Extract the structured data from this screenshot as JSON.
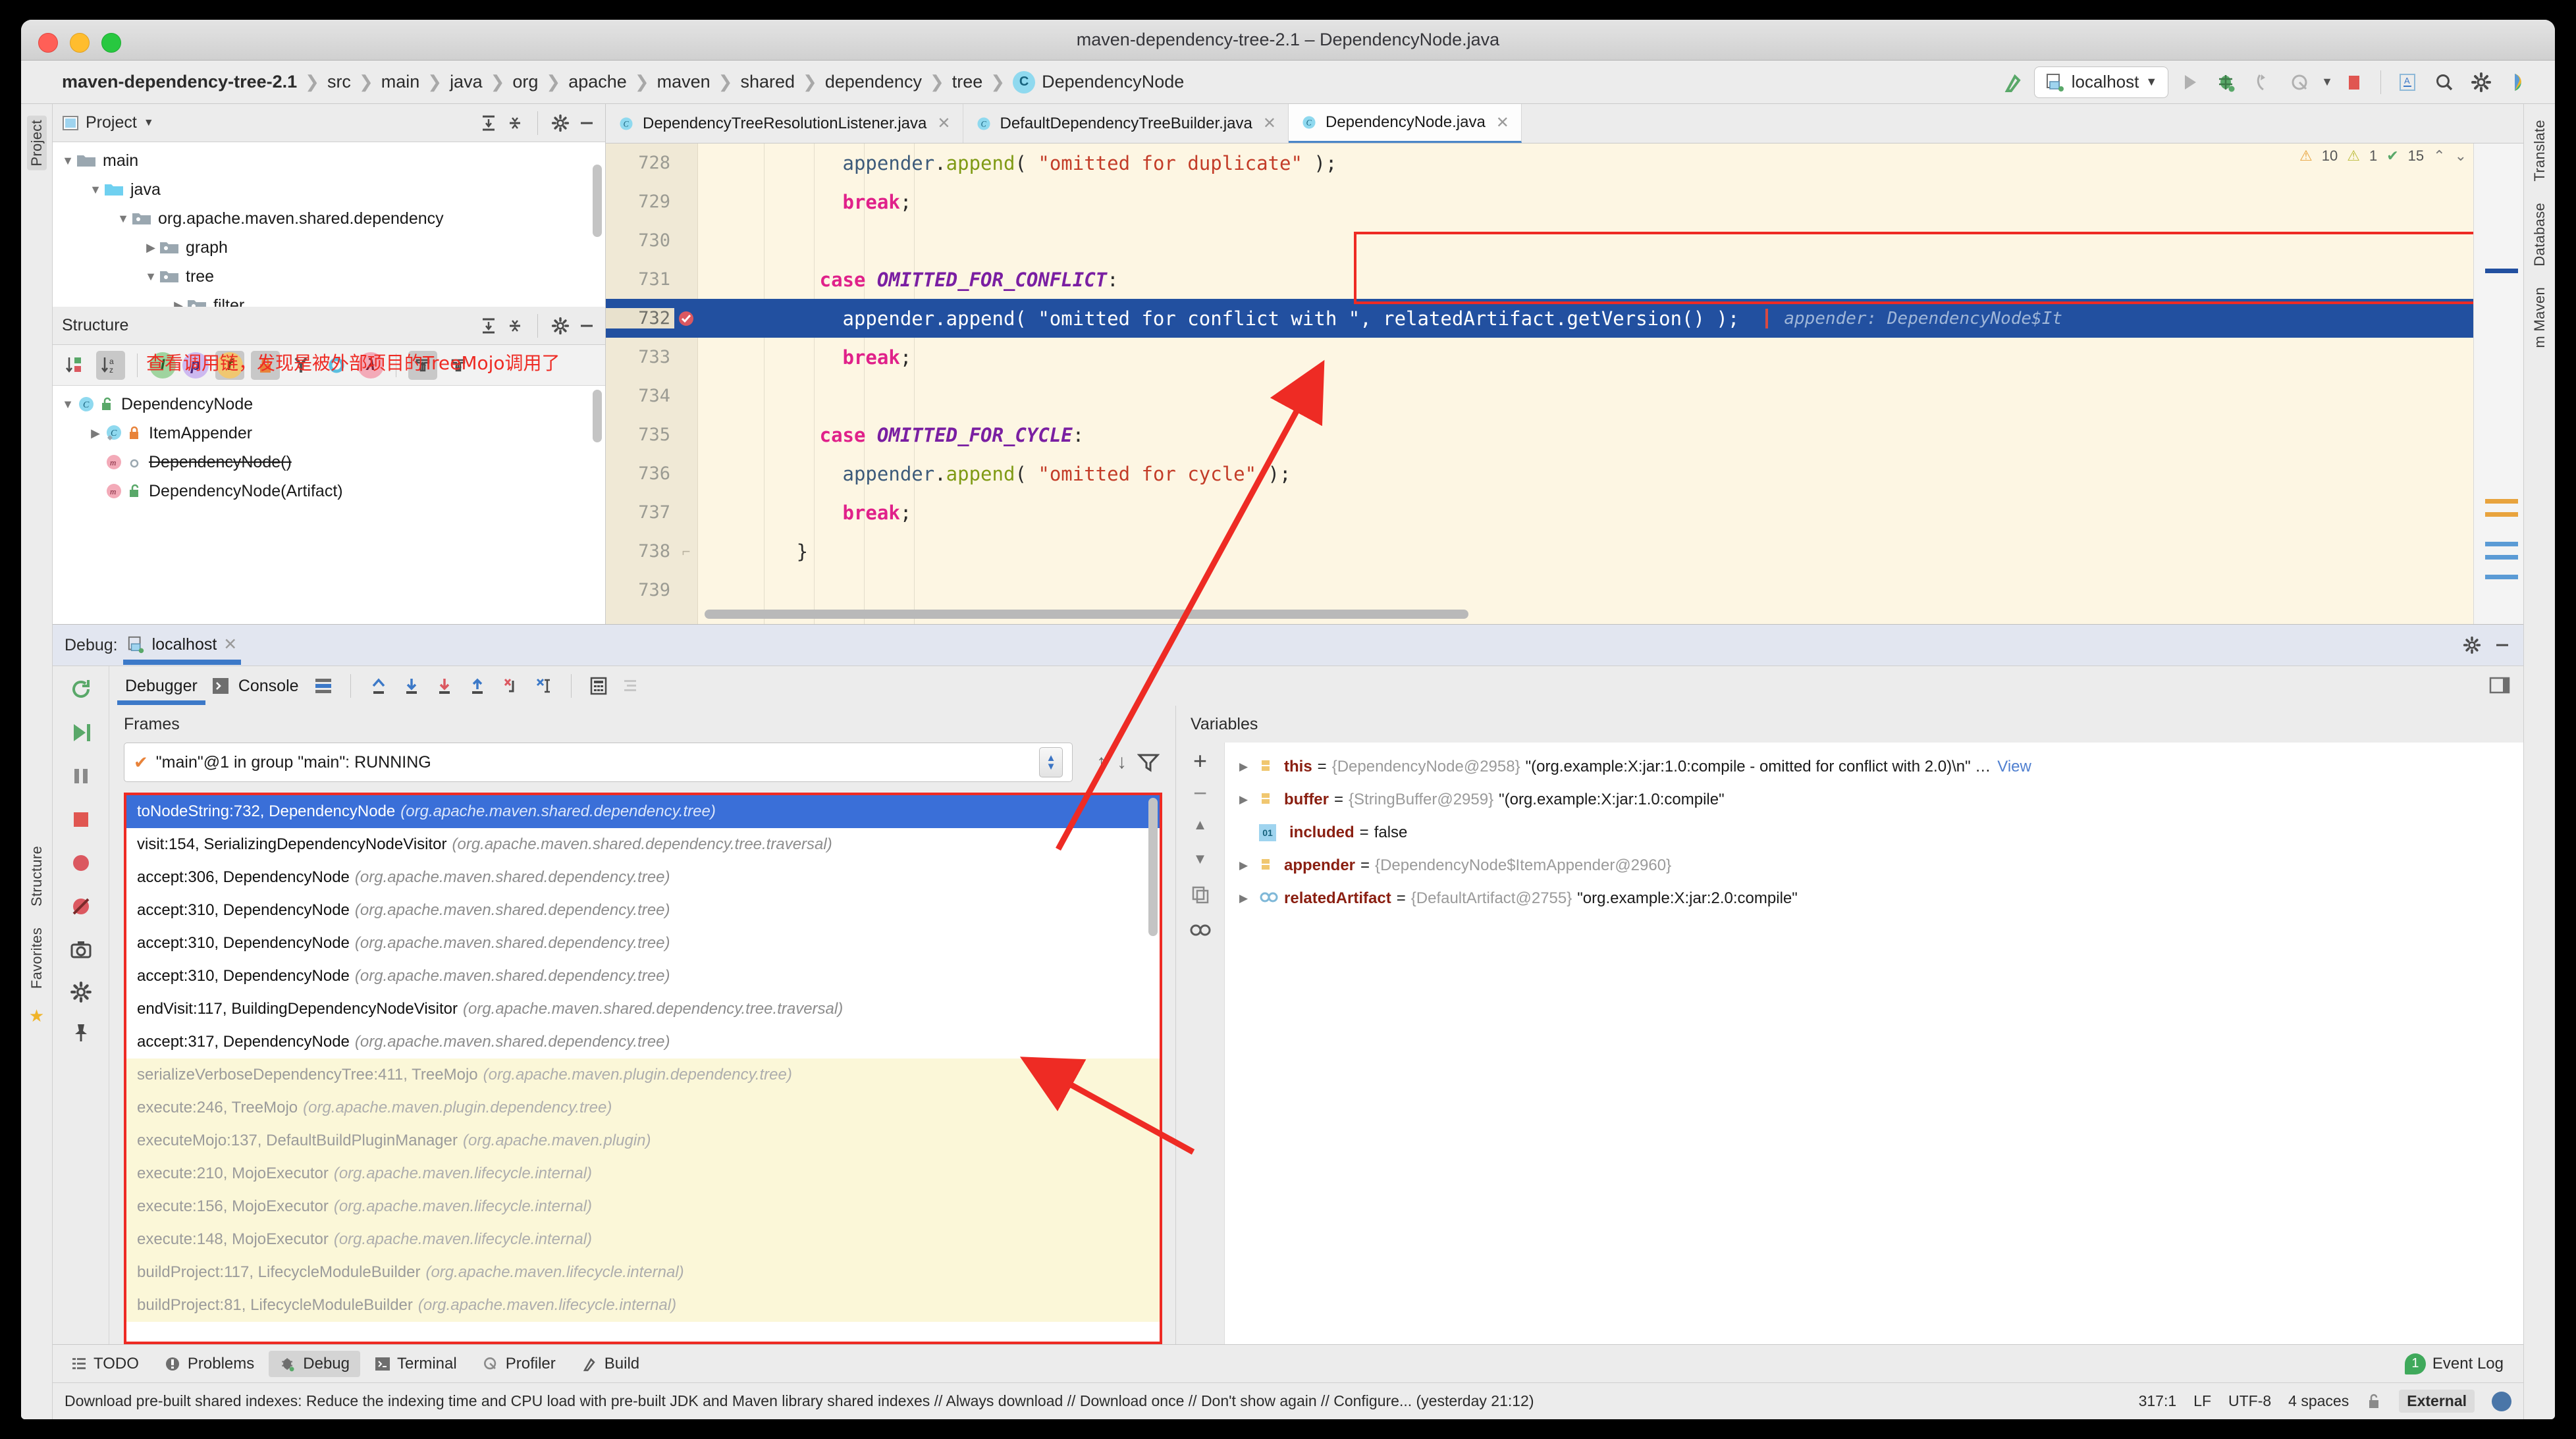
{
  "window": {
    "title": "maven-dependency-tree-2.1 – DependencyNode.java"
  },
  "breadcrumb": {
    "items": [
      "maven-dependency-tree-2.1",
      "src",
      "main",
      "java",
      "org",
      "apache",
      "maven",
      "shared",
      "dependency",
      "tree"
    ],
    "final_class": "DependencyNode",
    "class_badge": "C"
  },
  "toolbar": {
    "run_config": "localhost",
    "icons": [
      "build-icon",
      "run-icon",
      "debug-icon",
      "step-over-icon",
      "attach-profiler-icon",
      "stop-icon",
      "translate-icon",
      "search-everywhere-icon",
      "settings-icon",
      "ai-assistant-icon"
    ]
  },
  "left_rail": {
    "tabs": [
      "Project",
      "Structure",
      "Favorites"
    ]
  },
  "right_rail": {
    "tabs": [
      "Translate",
      "Database",
      "m Maven"
    ]
  },
  "project_panel": {
    "title": "Project",
    "items": [
      {
        "label": "main",
        "depth": 0,
        "arrow": "down",
        "kind": "folder-grey"
      },
      {
        "label": "java",
        "depth": 1,
        "arrow": "down",
        "kind": "folder-blue"
      },
      {
        "label": "org.apache.maven.shared.dependency",
        "depth": 2,
        "arrow": "down",
        "kind": "package"
      },
      {
        "label": "graph",
        "depth": 3,
        "arrow": "right",
        "kind": "package"
      },
      {
        "label": "tree",
        "depth": 3,
        "arrow": "down",
        "kind": "package"
      },
      {
        "label": "filter",
        "depth": 4,
        "arrow": "right",
        "kind": "package"
      }
    ]
  },
  "structure_panel": {
    "title": "Structure",
    "toolbar_icons": [
      "sort-by-visibility-icon",
      "sort-alphabetically-icon",
      "show-inherited-icon",
      "show-properties-icon",
      "show-fields-icon",
      "show-non-public-icon",
      "show-anonymous-icon",
      "show-interfaces-icon",
      "show-lambdas-icon",
      "expand-all-icon",
      "collapse-all-icon"
    ],
    "items": [
      {
        "label": "DependencyNode",
        "depth": 0,
        "arrow": "down",
        "kind": "class",
        "vis": "public",
        "struck": false
      },
      {
        "label": "ItemAppender",
        "depth": 1,
        "arrow": "right",
        "kind": "class",
        "vis": "private",
        "struck": false
      },
      {
        "label": "DependencyNode()",
        "depth": 1,
        "arrow": "",
        "kind": "method",
        "vis": "package",
        "struck": true
      },
      {
        "label": "DependencyNode(Artifact)",
        "depth": 1,
        "arrow": "",
        "kind": "method",
        "vis": "public",
        "struck": false
      }
    ]
  },
  "editor": {
    "tabs": [
      {
        "label": "DependencyTreeResolutionListener.java",
        "active": false
      },
      {
        "label": "DefaultDependencyTreeBuilder.java",
        "active": false
      },
      {
        "label": "DependencyNode.java",
        "active": true
      }
    ],
    "inspection": {
      "warnings": "10",
      "weak_warnings": "1",
      "checks": "15"
    },
    "lines": [
      {
        "num": "728",
        "html": "            appender.append( \"omitted for duplicate\" );",
        "bp": false,
        "hl": false
      },
      {
        "num": "729",
        "html": "            break;",
        "bp": false,
        "hl": false
      },
      {
        "num": "730",
        "html": "",
        "bp": false,
        "hl": false
      },
      {
        "num": "731",
        "html": "          case OMITTED_FOR_CONFLICT:",
        "bp": false,
        "hl": false
      },
      {
        "num": "732",
        "html": "            appender.append( \"omitted for conflict with \", relatedArtifact.getVersion() );",
        "bp": true,
        "hl": true,
        "inline_hint": "appender: DependencyNode$It"
      },
      {
        "num": "733",
        "html": "            break;",
        "bp": false,
        "hl": false
      },
      {
        "num": "734",
        "html": "",
        "bp": false,
        "hl": false
      },
      {
        "num": "735",
        "html": "          case OMITTED_FOR_CYCLE:",
        "bp": false,
        "hl": false
      },
      {
        "num": "736",
        "html": "            appender.append( \"omitted for cycle\" );",
        "bp": false,
        "hl": false
      },
      {
        "num": "737",
        "html": "            break;",
        "bp": false,
        "hl": false
      },
      {
        "num": "738",
        "html": "        }",
        "bp": false,
        "hl": false
      },
      {
        "num": "739",
        "html": "",
        "bp": false,
        "hl": false
      }
    ]
  },
  "debug": {
    "header_label": "Debug:",
    "session_name": "localhost",
    "tabs": [
      "Debugger",
      "Console"
    ],
    "active_tab": "Debugger",
    "frames_title": "Frames",
    "thread": "\"main\"@1 in group \"main\": RUNNING",
    "frames": [
      {
        "name": "toNodeString:732, DependencyNode",
        "pkg": "(org.apache.maven.shared.dependency.tree)",
        "state": "selected"
      },
      {
        "name": "visit:154, SerializingDependencyNodeVisitor",
        "pkg": "(org.apache.maven.shared.dependency.tree.traversal)",
        "state": "normal"
      },
      {
        "name": "accept:306, DependencyNode",
        "pkg": "(org.apache.maven.shared.dependency.tree)",
        "state": "normal"
      },
      {
        "name": "accept:310, DependencyNode",
        "pkg": "(org.apache.maven.shared.dependency.tree)",
        "state": "normal"
      },
      {
        "name": "accept:310, DependencyNode",
        "pkg": "(org.apache.maven.shared.dependency.tree)",
        "state": "normal"
      },
      {
        "name": "accept:310, DependencyNode",
        "pkg": "(org.apache.maven.shared.dependency.tree)",
        "state": "normal"
      },
      {
        "name": "endVisit:117, BuildingDependencyNodeVisitor",
        "pkg": "(org.apache.maven.shared.dependency.tree.traversal)",
        "state": "normal"
      },
      {
        "name": "accept:317, DependencyNode",
        "pkg": "(org.apache.maven.shared.dependency.tree)",
        "state": "normal"
      },
      {
        "name": "serializeVerboseDependencyTree:411, TreeMojo",
        "pkg": "(org.apache.maven.plugin.dependency.tree)",
        "state": "library"
      },
      {
        "name": "execute:246, TreeMojo",
        "pkg": "(org.apache.maven.plugin.dependency.tree)",
        "state": "library"
      },
      {
        "name": "executeMojo:137, DefaultBuildPluginManager",
        "pkg": "(org.apache.maven.plugin)",
        "state": "library"
      },
      {
        "name": "execute:210, MojoExecutor",
        "pkg": "(org.apache.maven.lifecycle.internal)",
        "state": "library"
      },
      {
        "name": "execute:156, MojoExecutor",
        "pkg": "(org.apache.maven.lifecycle.internal)",
        "state": "library"
      },
      {
        "name": "execute:148, MojoExecutor",
        "pkg": "(org.apache.maven.lifecycle.internal)",
        "state": "library"
      },
      {
        "name": "buildProject:117, LifecycleModuleBuilder",
        "pkg": "(org.apache.maven.lifecycle.internal)",
        "state": "library"
      },
      {
        "name": "buildProject:81, LifecycleModuleBuilder",
        "pkg": "(org.apache.maven.lifecycle.internal)",
        "state": "library"
      }
    ],
    "variables_title": "Variables",
    "variables": [
      {
        "tri": true,
        "icon": "field-icon",
        "name": "this",
        "value_ref": "{DependencyNode@2958}",
        "value_str": "\"(org.example:X:jar:1.0:compile - omitted for conflict with 2.0)\\n\" …",
        "link": "View"
      },
      {
        "tri": true,
        "icon": "field-icon",
        "name": "buffer",
        "value_ref": "{StringBuffer@2959}",
        "value_str": "\"(org.example:X:jar:1.0:compile\"",
        "link": ""
      },
      {
        "tri": false,
        "icon": "boolean-icon",
        "name": "included",
        "value_ref": "",
        "value_str": "false",
        "link": ""
      },
      {
        "tri": true,
        "icon": "field-icon",
        "name": "appender",
        "value_ref": "{DependencyNode$ItemAppender@2960}",
        "value_str": "",
        "link": ""
      },
      {
        "tri": true,
        "icon": "interface-icon",
        "name": "relatedArtifact",
        "value_ref": "{DefaultArtifact@2755}",
        "value_str": "\"org.example:X:jar:2.0:compile\"",
        "link": ""
      }
    ]
  },
  "annotation": {
    "chinese_note": "查看调用链，发现是被外部项目的TreeMojo调用了"
  },
  "tool_window_bar": {
    "items": [
      {
        "label": "TODO",
        "icon": "todo-icon",
        "active": false
      },
      {
        "label": "Problems",
        "icon": "problems-icon",
        "active": false
      },
      {
        "label": "Debug",
        "icon": "debug-icon",
        "active": true
      },
      {
        "label": "Terminal",
        "icon": "terminal-icon",
        "active": false
      },
      {
        "label": "Profiler",
        "icon": "profiler-icon",
        "active": false
      },
      {
        "label": "Build",
        "icon": "build-icon",
        "active": false
      }
    ],
    "event_log": {
      "label": "Event Log",
      "count": "1"
    }
  },
  "status_bar": {
    "message": "Download pre-built shared indexes: Reduce the indexing time and CPU load with pre-built JDK and Maven library shared indexes // Always download // Download once // Don't show again // Configure... (yesterday 21:12)",
    "caret": "317:1",
    "line_sep": "LF",
    "encoding": "UTF-8",
    "indent": "4 spaces",
    "branch": "External"
  },
  "colors": {
    "selection_blue": "#2250a0",
    "frame_selected": "#3a6fd8",
    "library_frame_bg": "#fbf7d8",
    "annotation_red": "#ee2b24",
    "editor_bg": "#fdf6e3",
    "accent": "#3c79c8"
  }
}
